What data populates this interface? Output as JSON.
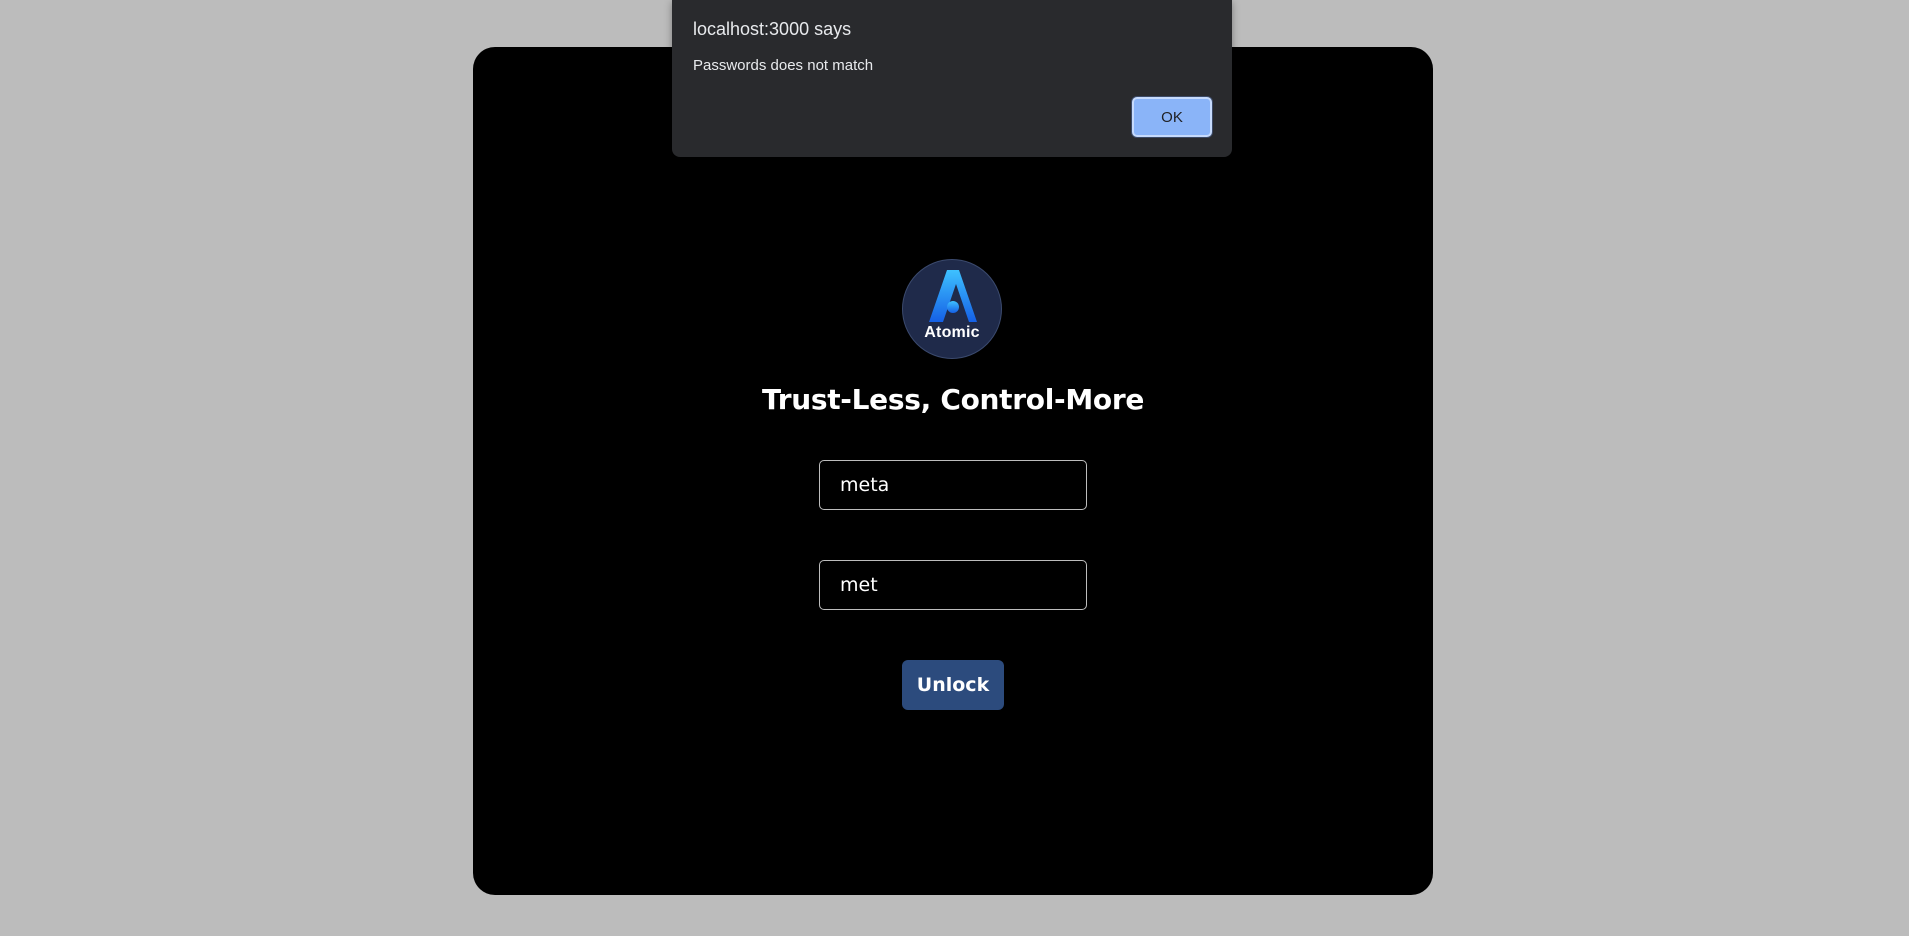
{
  "dialog": {
    "title": "localhost:3000 says",
    "message": "Passwords does not match",
    "ok_label": "OK"
  },
  "app": {
    "logo_text": "Atomic",
    "tagline": "Trust-Less, Control-More",
    "password_value": "meta",
    "confirm_value": "met",
    "unlock_label": "Unlock"
  },
  "colors": {
    "page_background": "#bcbcbc",
    "card_background": "#000000",
    "button": "#2c4b7d",
    "dialog_background": "#292a2d",
    "dialog_button": "#8ab4f8",
    "logo_background": "#1f2a4a",
    "logo_accent": "#1e9bf0"
  },
  "icons": {
    "logo": "atomic-a-logo-icon"
  }
}
